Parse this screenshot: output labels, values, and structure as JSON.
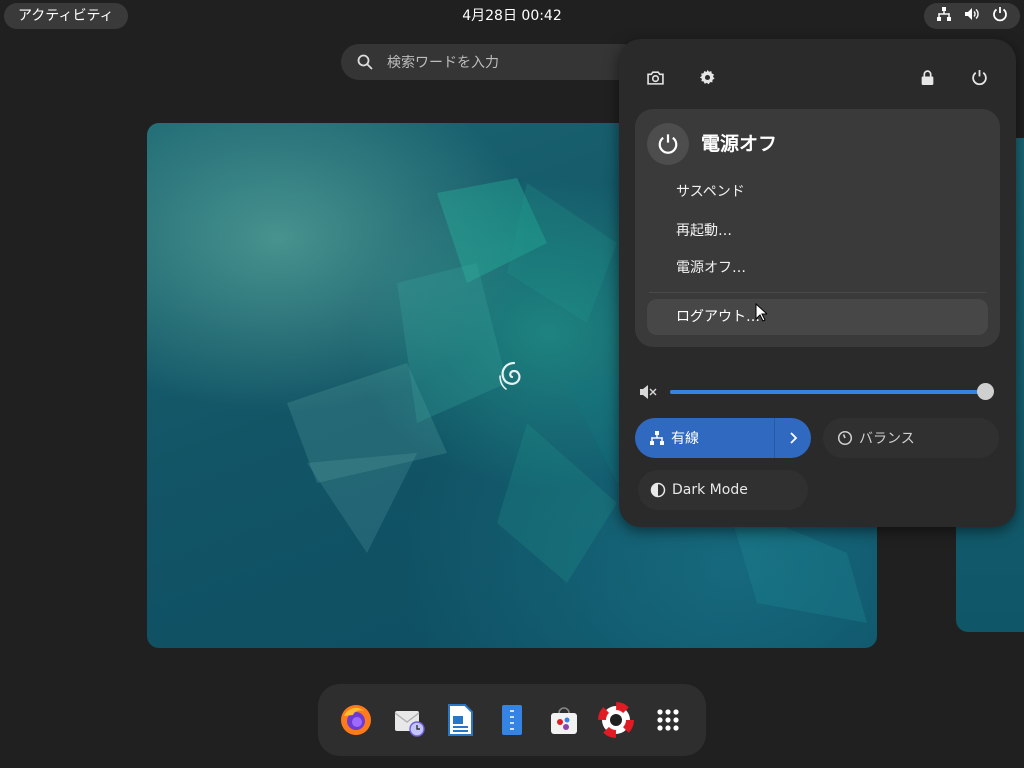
{
  "topbar": {
    "activities_label": "アクティビティ",
    "clock": "4月28日  00:42",
    "status_icons": [
      "network-wired-icon",
      "volume-icon",
      "power-icon"
    ]
  },
  "search": {
    "placeholder": "検索ワードを入力"
  },
  "quick_settings": {
    "top_buttons": [
      "screenshot-icon",
      "settings-gear-icon",
      "lock-icon",
      "power-icon"
    ],
    "power_menu": {
      "title": "電源オフ",
      "items": [
        "サスペンド",
        "再起動…",
        "電源オフ…"
      ],
      "logout": "ログアウト…"
    },
    "volume": {
      "level": 1.0,
      "muted_icon": true
    },
    "toggles": {
      "wired": {
        "label": "有線",
        "active": true
      },
      "power_profile": {
        "label": "バランス",
        "active": false
      },
      "dark_mode": {
        "label": "Dark Mode",
        "active": false
      }
    }
  },
  "dash": {
    "apps": [
      "firefox-icon",
      "evolution-mail-clock-icon",
      "libreoffice-writer-icon",
      "text-editor-icon",
      "software-store-icon",
      "help-lifebuoy-icon",
      "app-grid-icon"
    ]
  },
  "colors": {
    "accent": "#3584e4",
    "toggle_active": "#3069c0",
    "panel_bg": "#2a2a2a",
    "desktop_bg": "#202020"
  }
}
